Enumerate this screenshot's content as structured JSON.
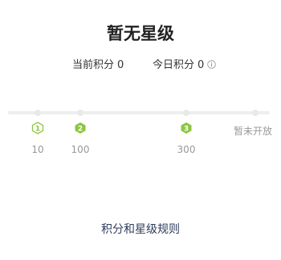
{
  "title": "暂无星级",
  "stats": {
    "current_label": "当前积分",
    "current_value": "0",
    "today_label": "今日积分",
    "today_value": "0",
    "info_icon": "info-icon"
  },
  "levels": [
    {
      "badge": "1",
      "points": "10",
      "style": "outline"
    },
    {
      "badge": "2",
      "points": "100",
      "style": "filled"
    },
    {
      "badge": "3",
      "points": "300",
      "style": "filled"
    }
  ],
  "unopened_label": "暂未开放",
  "rules_link": "积分和星级规则",
  "colors": {
    "accent_green": "#8cc63f",
    "track": "#eeeeee",
    "muted_text": "#999999",
    "link_text": "#2e3d5c"
  }
}
